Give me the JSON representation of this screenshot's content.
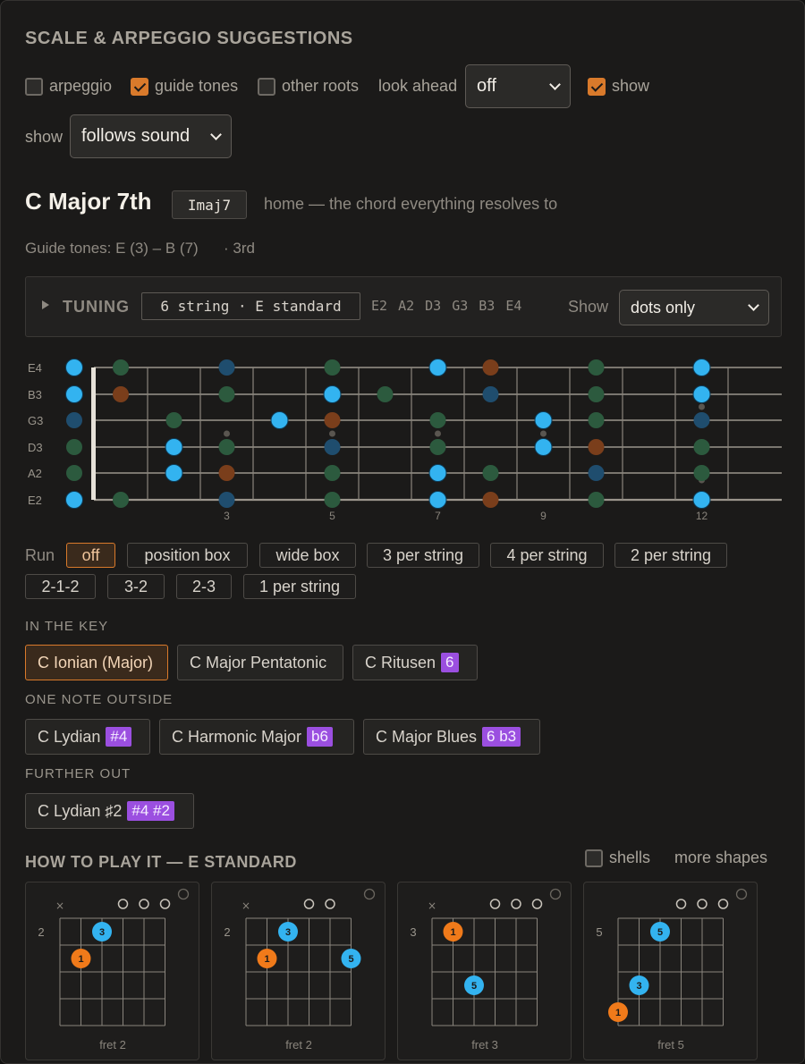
{
  "header": {
    "title": "SCALE & ARPEGGIO SUGGESTIONS"
  },
  "controls": {
    "arpeggio_label": "arpeggio",
    "arpeggio_checked": false,
    "guide_tones_label": "guide tones",
    "guide_tones_checked": true,
    "other_roots_label": "other roots",
    "other_roots_checked": false,
    "look_ahead_label": "look ahead",
    "look_ahead_value": "off",
    "show_label": "show",
    "show_checked": true,
    "show2_label": "show",
    "show2_value": "follows sound"
  },
  "chord": {
    "name": "C Major 7th",
    "roman": "Imaj7",
    "function": "home — the chord everything resolves to",
    "guide_tones": "Guide tones: E (3) – B (7)",
    "guide_extra": "· 3rd"
  },
  "tuning": {
    "label": "TUNING",
    "value": "6 string · E standard",
    "strings": [
      "E2",
      "A2",
      "D3",
      "G3",
      "B3",
      "E4"
    ],
    "show_label": "Show",
    "show_value": "dots only"
  },
  "fretboard": {
    "string_labels": [
      "E4",
      "B3",
      "G3",
      "D3",
      "A2",
      "E2"
    ],
    "fret_numbers": [
      "3",
      "5",
      "7",
      "9",
      "12"
    ]
  },
  "run": {
    "label": "Run",
    "options": [
      "off",
      "position box",
      "wide box",
      "3 per string",
      "4 per string",
      "2 per string",
      "2-1-2",
      "3-2",
      "2-3",
      "1 per string"
    ],
    "selected": "off"
  },
  "scales": {
    "in_key_title": "IN THE KEY",
    "in_key": [
      {
        "name": "C Ionian (Major)",
        "tag": ""
      },
      {
        "name": "C Major Pentatonic",
        "tag": ""
      },
      {
        "name": "C Ritusen",
        "tag": "6"
      }
    ],
    "one_out_title": "ONE NOTE OUTSIDE",
    "one_out": [
      {
        "name": "C Lydian",
        "tag": "#4"
      },
      {
        "name": "C Harmonic Major",
        "tag": "b6"
      },
      {
        "name": "C Major Blues",
        "tag": "6 b3"
      }
    ],
    "further_title": "FURTHER OUT",
    "further": [
      {
        "name": "C Lydian ♯2",
        "tag": "#4 #2"
      }
    ]
  },
  "play": {
    "title": "HOW TO PLAY IT — E STANDARD",
    "shells_label": "shells",
    "more_label": "more shapes",
    "cards": [
      {
        "start_fret": "2",
        "caption": "fret 2"
      },
      {
        "start_fret": "2",
        "caption": "fret 2"
      },
      {
        "start_fret": "3",
        "caption": "fret 3"
      },
      {
        "start_fret": "5",
        "caption": "fret 5"
      }
    ]
  },
  "colors": {
    "accent": "#d97a2b",
    "chord_tone": "#33b3f0",
    "root": "#f07a1a",
    "tag": "#9b4fe0"
  }
}
